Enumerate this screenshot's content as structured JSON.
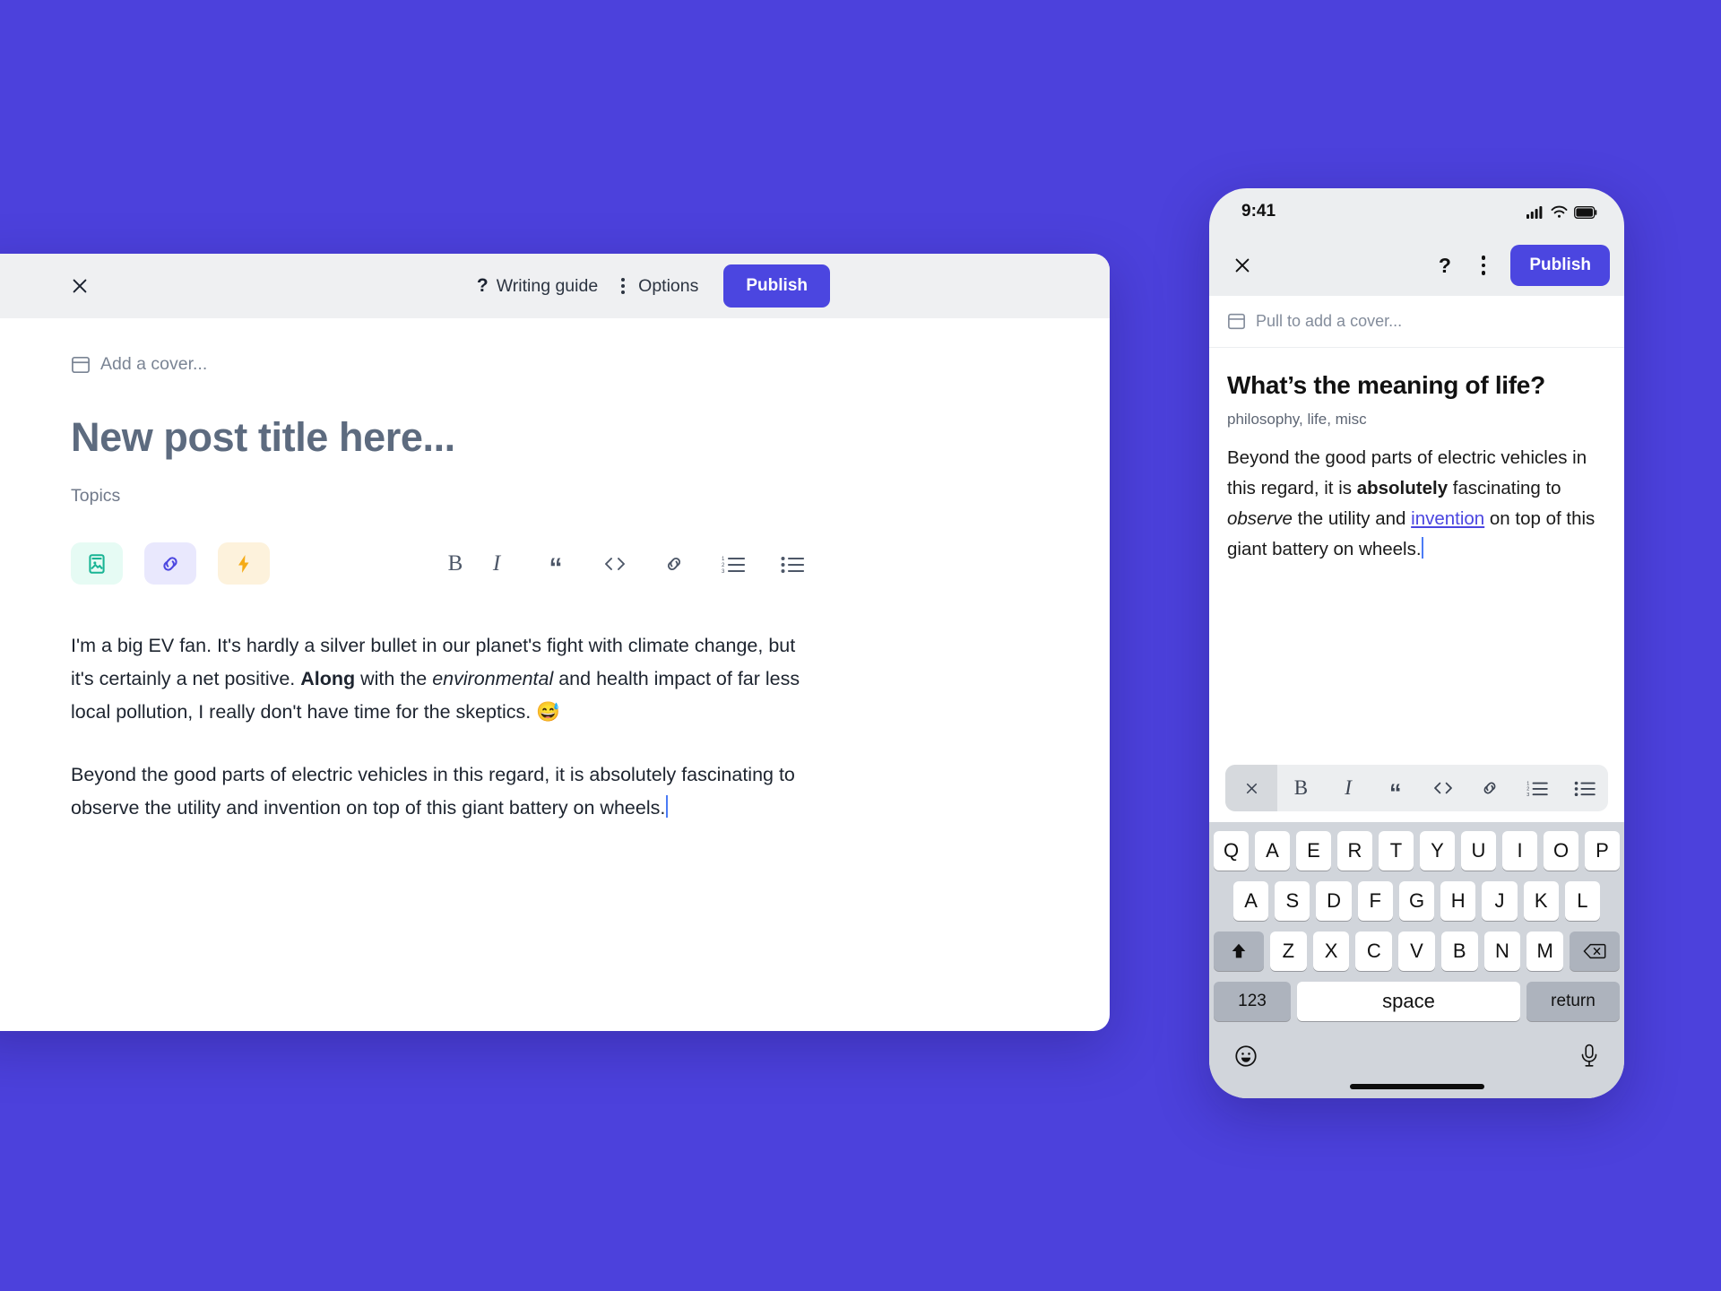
{
  "background_color": "#4c41dc",
  "desktop": {
    "topbar": {
      "close_icon": "close-icon",
      "writing_guide_label": "Writing guide",
      "options_label": "Options",
      "publish_label": "Publish",
      "publish_color": "#4b46e0"
    },
    "cover_label": "Add a cover...",
    "title_placeholder": "New post title here...",
    "topics_placeholder": "Topics",
    "toolbar": {
      "chips": [
        {
          "name": "image-chip",
          "icon": "image-icon",
          "bg": "#e6fbf4",
          "fg": "#18b494"
        },
        {
          "name": "link-chip",
          "icon": "link-icon",
          "bg": "#e9e8fd",
          "fg": "#4b46e0"
        },
        {
          "name": "bolt-chip",
          "icon": "lightning-icon",
          "bg": "#fdf2dc",
          "fg": "#f5ab16"
        }
      ],
      "tools": [
        {
          "name": "bold-button",
          "glyph": "B"
        },
        {
          "name": "italic-button",
          "glyph": "I"
        },
        {
          "name": "quote-button",
          "glyph": "“"
        },
        {
          "name": "code-button",
          "glyph": "<>"
        },
        {
          "name": "link-button",
          "glyph": "link"
        },
        {
          "name": "numbered-list-button",
          "glyph": "ol"
        },
        {
          "name": "bullet-list-button",
          "glyph": "ul"
        }
      ]
    },
    "paragraph1": {
      "part1": "I'm a big EV fan. It's hardly a silver bullet in our planet's fight with climate change, but it's certainly a net positive. ",
      "bold": "Along",
      "part2": " with the ",
      "italic": "environmental",
      "part3": " and health impact of far less local pollution, I really don't have time for the skeptics. 😅"
    },
    "paragraph2": "Beyond the good parts of electric vehicles in this regard, it is absolutely fascinating to observe the utility and invention on top of this giant battery on wheels."
  },
  "phone": {
    "status_time": "9:41",
    "status_icons": [
      "signal-icon",
      "wifi-icon",
      "battery-icon"
    ],
    "header": {
      "close_icon": "close-icon",
      "help_label": "?",
      "menu_icon": "kebab-menu-icon",
      "publish_label": "Publish"
    },
    "cover_label": "Pull to add a cover...",
    "title": "What’s the meaning of life?",
    "topics": "philosophy, life, misc",
    "body": {
      "part1": "Beyond the good parts of electric vehicles in this regard, it is ",
      "bold": "absolutely",
      "part2": " fascinating to ",
      "italic": "observe",
      "part3": " the utility and ",
      "link": "invention",
      "part4": " on top of this giant battery on wheels."
    },
    "fmt_tools": [
      {
        "name": "close-format-button",
        "glyph": "×"
      },
      {
        "name": "bold-button",
        "glyph": "B"
      },
      {
        "name": "italic-button",
        "glyph": "I"
      },
      {
        "name": "quote-button",
        "glyph": "“"
      },
      {
        "name": "code-button",
        "glyph": "<>"
      },
      {
        "name": "link-button",
        "glyph": "link"
      },
      {
        "name": "numbered-list-button",
        "glyph": "ol"
      },
      {
        "name": "bullet-list-button",
        "glyph": "ul"
      }
    ],
    "keyboard": {
      "row1": [
        "Q",
        "A",
        "E",
        "R",
        "T",
        "Y",
        "U",
        "I",
        "O",
        "P"
      ],
      "row2": [
        "A",
        "S",
        "D",
        "F",
        "G",
        "H",
        "J",
        "K",
        "L"
      ],
      "row3": [
        "Z",
        "X",
        "C",
        "V",
        "B",
        "N",
        "M"
      ],
      "shift_icon": "shift-up-icon",
      "backspace_icon": "backspace-icon",
      "numbers_label": "123",
      "space_label": "space",
      "return_label": "return",
      "emoji_icon": "emoji-smiley-icon",
      "mic_icon": "microphone-icon"
    }
  }
}
